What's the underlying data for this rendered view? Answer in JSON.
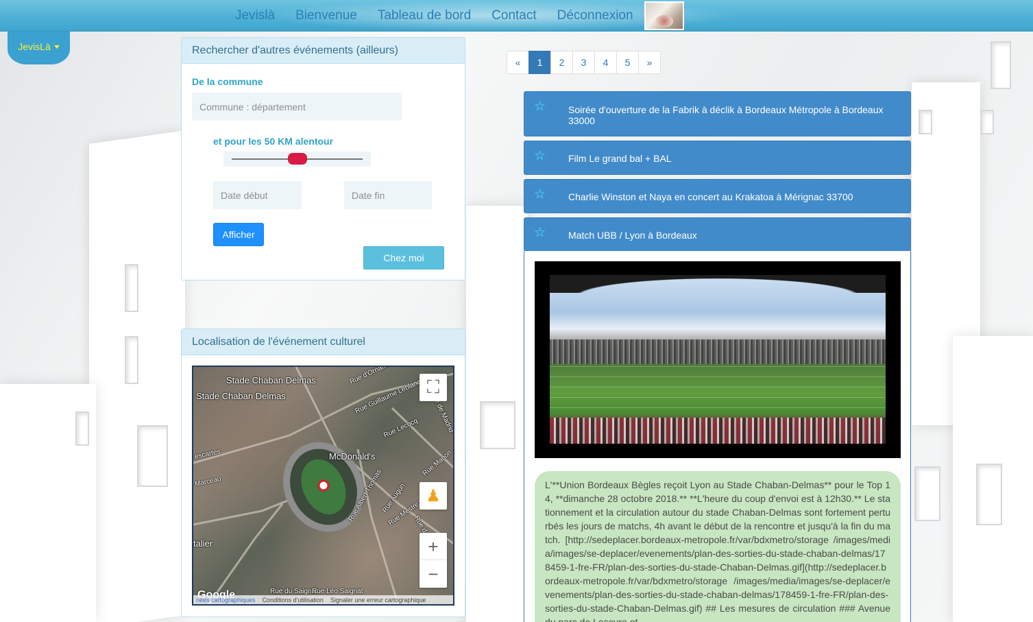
{
  "nav": {
    "items": [
      "Jevislà",
      "Bienvenue",
      "Tableau de bord",
      "Contact",
      "Déconnexion"
    ]
  },
  "user_menu": {
    "label": "JevisLà"
  },
  "search_panel": {
    "title": "Rechercher d'autres événements (ailleurs)",
    "commune_label": "De la commune",
    "commune_placeholder": "Commune : département",
    "radius_label": "et pour les 50 KM alentour",
    "radius_value_km": 50,
    "date_start_placeholder": "Date début",
    "date_end_placeholder": "Date fin",
    "show_button": "Afficher",
    "home_button": "Chez moi"
  },
  "map_panel": {
    "title": "Localisation de l'événement culturel",
    "labels": {
      "stade1": "Stade Chaban Delmas",
      "stade2": "Stade Chaban Delmas",
      "mcdonalds": "McDonald's",
      "omano": "Rue d'Ornano",
      "leblanc": "Rue Guillaume Leblanc",
      "lecocq": "Rue Lecocq",
      "madrid": "Rue de Madrid",
      "manon": "Rue Manon",
      "marceau": "Marceau",
      "descartes": "escartes",
      "albert": "Rue Albert Thomas",
      "augun": "Rue Augun",
      "mestrezat": "Rue Mestrezat",
      "ruee": "Rue d",
      "italier": "talier",
      "saignat": "Rue Léo Saignat",
      "saignat2": "Rue du Saignat"
    },
    "google": "Google",
    "footer": [
      "nées cartographiques",
      "Conditions d'utilisation",
      "Signaler une erreur cartographique"
    ]
  },
  "pagination": {
    "prev": "«",
    "pages": [
      "1",
      "2",
      "3",
      "4",
      "5"
    ],
    "next": "»",
    "active": "1"
  },
  "events": [
    {
      "title": "Soirée d'ouverture de la Fabrik à déclik à Bordeaux Métropole à Bordeaux 33000"
    },
    {
      "title": "Film Le grand bal + BAL"
    },
    {
      "title": "Charlie Winston et Naya en concert au Krakatoa à Mérignac 33700"
    },
    {
      "title": "Match UBB / Lyon à Bordeaux"
    }
  ],
  "event_detail": {
    "description": "L'**Union Bordeaux Bègles reçoit Lyon au Stade Chaban-Delmas** pour le Top 14, **dimanche 28 octobre 2018.** **L'heure du coup d'envoi est à 12h30.** Le stationnement et la circulation autour du stade Chaban-Delmas sont fortement perturbés les jours de matchs, 4h avant le début de la rencontre et jusqu'à la fin du match. [http://sedeplacer.bordeaux-metropole.fr/var/bdxmetro/storage /images/media/images/se-deplacer/evenements/plan-des-sorties-du-stade-chaban-delmas/178459-1-fre-FR/plan-des-sorties-du-stade-Chaban-Delmas.gif](http://sedeplacer.bordeaux-metropole.fr/var/bdxmetro/storage /images/media/images/se-deplacer/evenements/plan-des-sorties-du-stade-chaban-delmas/178459-1-fre-FR/plan-des-sorties-du-stade-Chaban-Delmas.gif) ## Les mesures de circulation ### Avenue du parc de Lescure et"
  },
  "colors": {
    "nav_bar": "#4fb1d6",
    "nav_link": "#2a7fb5",
    "user_tab": "#3aa1d1",
    "user_tab_text": "#f7f13a",
    "panel_head": "#d9edf7",
    "event_bar": "#428bca",
    "star": "#3ff2ff",
    "slider_thumb": "#d91a45",
    "description_bg": "#c8e6c1"
  }
}
